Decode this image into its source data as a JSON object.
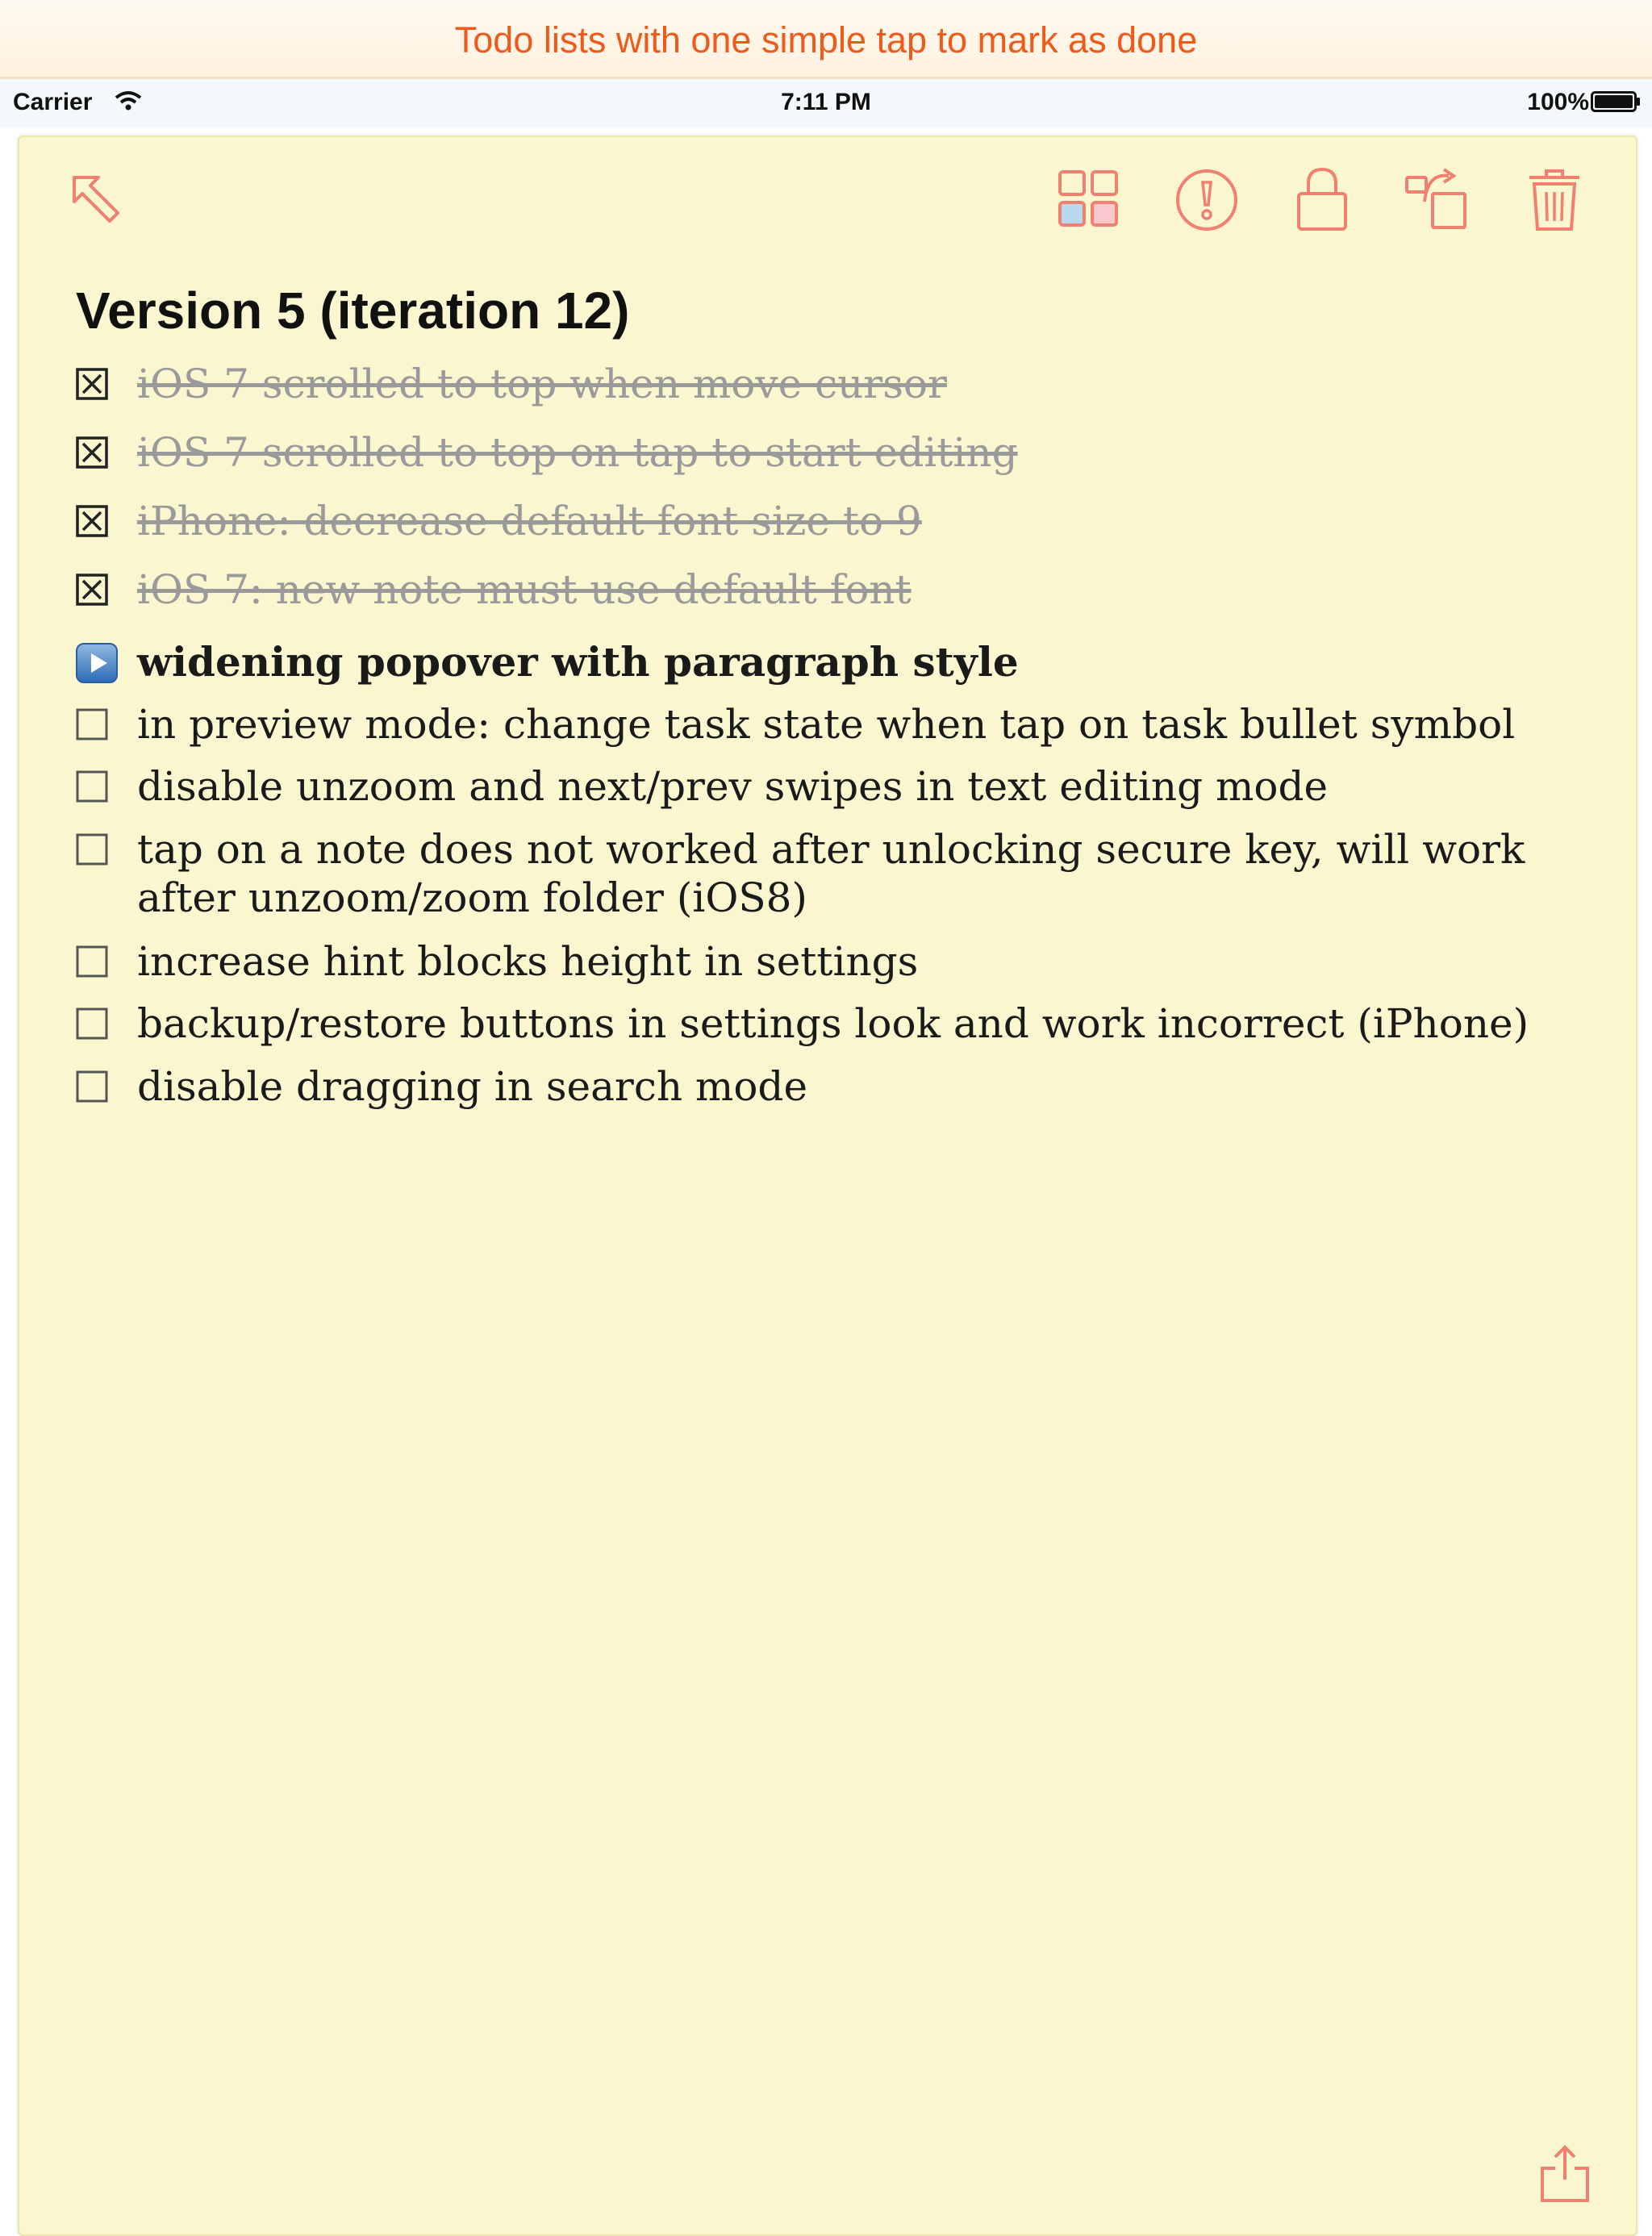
{
  "banner": {
    "text": "Todo lists with one simple tap to mark as done"
  },
  "status_bar": {
    "carrier": "Carrier",
    "time": "7:11 PM",
    "battery": "100%"
  },
  "toolbar": {
    "back_icon": "arrow-up-left-icon",
    "icons": [
      "grid-icon",
      "alert-icon",
      "lock-icon",
      "move-icon",
      "trash-icon"
    ],
    "accent_color": "#f08070"
  },
  "note": {
    "background": "#faf6cf",
    "title": "Version 5 (iteration 12)",
    "tasks": [
      {
        "state": "done",
        "text": "iOS 7 scrolled to top when move cursor"
      },
      {
        "state": "done",
        "text": "iOS 7 scrolled to top on tap to start editing"
      },
      {
        "state": "done",
        "text": "iPhone: decrease default font size to 9"
      },
      {
        "state": "done",
        "text": "iOS 7: new note must use  default font"
      },
      {
        "state": "in-progress",
        "text": "widening popover with paragraph style"
      },
      {
        "state": "open",
        "text": "in preview mode: change task state when tap on task bullet symbol"
      },
      {
        "state": "open",
        "text": "disable unzoom and next/prev swipes in text editing mode"
      },
      {
        "state": "open",
        "text": "tap on a note does not worked after unlocking secure key, will work after unzoom/zoom folder (iOS8)"
      },
      {
        "state": "open",
        "text": "increase hint blocks height in settings"
      },
      {
        "state": "open",
        "text": "backup/restore buttons in settings look and work incorrect (iPhone)"
      },
      {
        "state": "open",
        "text": "disable dragging in search mode"
      }
    ],
    "share_icon": "share-icon"
  }
}
